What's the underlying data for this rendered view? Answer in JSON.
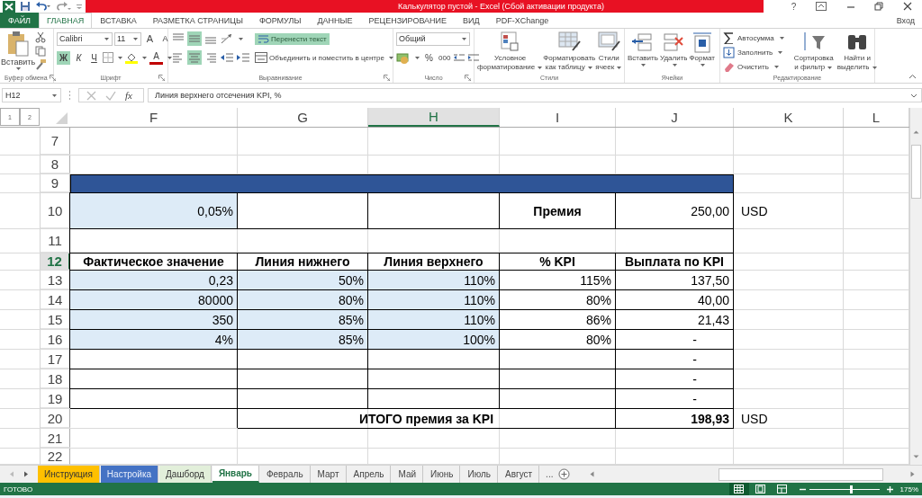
{
  "window": {
    "title": "Калькулятор пустой -  Excel (Сбой активации продукта)",
    "help": "?"
  },
  "ribbon_tabs": [
    {
      "label": "ФАЙЛ",
      "kind": "file",
      "selected": false
    },
    {
      "label": "ГЛАВНАЯ",
      "kind": "tab",
      "selected": true
    },
    {
      "label": "ВСТАВКА",
      "kind": "tab",
      "selected": false
    },
    {
      "label": "РАЗМЕТКА СТРАНИЦЫ",
      "kind": "tab",
      "selected": false
    },
    {
      "label": "ФОРМУЛЫ",
      "kind": "tab",
      "selected": false
    },
    {
      "label": "ДАННЫЕ",
      "kind": "tab",
      "selected": false
    },
    {
      "label": "РЕЦЕНЗИРОВАНИЕ",
      "kind": "tab",
      "selected": false
    },
    {
      "label": "ВИД",
      "kind": "tab",
      "selected": false
    },
    {
      "label": "PDF-XChange",
      "kind": "tab",
      "selected": false
    }
  ],
  "account": "Вход",
  "ribbon": {
    "groups": [
      {
        "kind": "clipboard",
        "label": "Буфер обмена",
        "paste": "Вставить"
      },
      {
        "kind": "font",
        "label": "Шрифт",
        "font": "Calibri",
        "size": "11",
        "grow": "A",
        "shrink": "A",
        "font_color": "A",
        "styles": [
          {
            "text": "Ж",
            "kind": "bold",
            "on": true
          },
          {
            "text": "К",
            "kind": "italic",
            "on": false
          },
          {
            "text": "Ч",
            "kind": "underline",
            "on": false
          }
        ]
      },
      {
        "kind": "alignment",
        "label": "Выравнивание",
        "valign": [
          {
            "on": false
          },
          {
            "on": true
          },
          {
            "on": false
          }
        ],
        "halign": [
          {
            "on": false
          },
          {
            "on": true
          },
          {
            "on": false
          }
        ],
        "wrap": {
          "text": "Перенести текст",
          "on": true
        },
        "merge": "Объединить и поместить в центре"
      },
      {
        "kind": "number",
        "label": "Число",
        "format": "Общий",
        "percent": "%",
        "thousands": "000"
      },
      {
        "kind": "styles",
        "label": "Стили",
        "buttons": [
          {
            "kind": "conditional",
            "lines": [
              "Условное",
              "форматирование"
            ]
          },
          {
            "kind": "table",
            "lines": [
              "Форматировать",
              "как таблицу"
            ]
          },
          {
            "kind": "cellstyle",
            "lines": [
              "Стили",
              "ячеек"
            ]
          }
        ]
      },
      {
        "kind": "cells",
        "label": "Ячейки",
        "buttons": [
          {
            "kind": "insert",
            "text": "Вставить"
          },
          {
            "kind": "delete",
            "text": "Удалить"
          },
          {
            "kind": "format",
            "text": "Формат"
          }
        ]
      },
      {
        "kind": "editing",
        "label": "Редактирование",
        "small": [
          {
            "kind": "sum",
            "text": "Автосумма"
          },
          {
            "kind": "fill",
            "text": "Заполнить"
          },
          {
            "kind": "clear",
            "text": "Очистить"
          }
        ],
        "buttons": [
          {
            "kind": "sort",
            "lines": [
              "Сортировка",
              "и фильтр"
            ]
          },
          {
            "kind": "find",
            "lines": [
              "Найти и",
              "выделить"
            ]
          }
        ]
      }
    ]
  },
  "formula_bar": {
    "name_box": "H12",
    "fx": "fx",
    "formula": "Линия верхнего отсечения KPI, %"
  },
  "outline_levels": [
    "1",
    "2"
  ],
  "columns": [
    {
      "label": "F",
      "selected": false
    },
    {
      "label": "G",
      "selected": false
    },
    {
      "label": "H",
      "selected": true
    },
    {
      "label": "I",
      "selected": false
    },
    {
      "label": "J",
      "selected": false
    },
    {
      "label": "K",
      "selected": false
    },
    {
      "label": "L",
      "selected": false
    }
  ],
  "rows": [
    {
      "number": "7",
      "selected": false,
      "cells": []
    },
    {
      "number": "8",
      "selected": false,
      "cells": []
    },
    {
      "number": "9",
      "selected": false,
      "cells": [
        {
          "kind": "band"
        },
        {
          "merged": true
        },
        {
          "merged": true
        },
        {
          "merged": true
        },
        {
          "merged": true
        }
      ]
    },
    {
      "number": "10",
      "selected": false,
      "cells": [
        {
          "kind": "input",
          "text": "0,05%"
        },
        {
          "kind": "box"
        },
        {
          "kind": "box"
        },
        {
          "kind": "label",
          "text": "Премия"
        },
        {
          "kind": "box",
          "text": "250,00"
        },
        {
          "kind": "plain",
          "text": "USD"
        }
      ]
    },
    {
      "number": "11",
      "selected": false,
      "cells": [
        {
          "kind": "box"
        },
        {
          "merged": true
        },
        {
          "merged": true
        },
        {
          "merged": true
        },
        {
          "merged": true
        }
      ]
    },
    {
      "number": "12",
      "selected": true,
      "cells": [
        {
          "kind": "label",
          "text": "Фактическое значение"
        },
        {
          "kind": "label",
          "text": "Линия нижнего"
        },
        {
          "kind": "label",
          "text": "Линия верхнего"
        },
        {
          "kind": "label",
          "text": "% KPI"
        },
        {
          "kind": "label",
          "text": "Выплата по KPI"
        }
      ]
    },
    {
      "number": "13",
      "selected": false,
      "cells": [
        {
          "kind": "input",
          "text": "0,23"
        },
        {
          "kind": "input",
          "text": "50%"
        },
        {
          "kind": "input",
          "text": "110%"
        },
        {
          "kind": "box",
          "text": "115%"
        },
        {
          "kind": "box",
          "text": "137,50"
        }
      ]
    },
    {
      "number": "14",
      "selected": false,
      "cells": [
        {
          "kind": "input",
          "text": "80000"
        },
        {
          "kind": "input",
          "text": "80%"
        },
        {
          "kind": "input",
          "text": "110%"
        },
        {
          "kind": "box",
          "text": "80%"
        },
        {
          "kind": "box",
          "text": "40,00"
        }
      ]
    },
    {
      "number": "15",
      "selected": false,
      "cells": [
        {
          "kind": "input",
          "text": "350"
        },
        {
          "kind": "input",
          "text": "85%"
        },
        {
          "kind": "input",
          "text": "110%"
        },
        {
          "kind": "box",
          "text": "86%"
        },
        {
          "kind": "box",
          "text": "21,43"
        }
      ]
    },
    {
      "number": "16",
      "selected": false,
      "cells": [
        {
          "kind": "input",
          "text": "4%"
        },
        {
          "kind": "input",
          "text": "85%"
        },
        {
          "kind": "input",
          "text": "100%"
        },
        {
          "kind": "box",
          "text": "80%"
        },
        {
          "kind": "dash",
          "text": "-"
        }
      ]
    },
    {
      "number": "17",
      "selected": false,
      "cells": [
        {
          "kind": "box"
        },
        {
          "kind": "box"
        },
        {
          "kind": "box"
        },
        {
          "kind": "box"
        },
        {
          "kind": "dash",
          "text": "-"
        }
      ]
    },
    {
      "number": "18",
      "selected": false,
      "cells": [
        {
          "kind": "box"
        },
        {
          "kind": "box"
        },
        {
          "kind": "box"
        },
        {
          "kind": "box"
        },
        {
          "kind": "dash",
          "text": "-"
        }
      ]
    },
    {
      "number": "19",
      "selected": false,
      "cells": [
        {
          "kind": "box"
        },
        {
          "kind": "box"
        },
        {
          "kind": "box"
        },
        {
          "kind": "box"
        },
        {
          "kind": "dash",
          "text": "-"
        }
      ]
    },
    {
      "number": "20",
      "selected": false,
      "cells": [
        {
          "kind": "blank"
        },
        {
          "kind": "label",
          "text": "ИТОГО премия за KPI"
        },
        {
          "merged": true
        },
        {
          "merged": true
        },
        {
          "kind": "sum",
          "text": "198,93"
        },
        {
          "kind": "plain",
          "text": "USD"
        }
      ]
    },
    {
      "number": "21",
      "selected": false,
      "cells": []
    },
    {
      "number": "22",
      "selected": false,
      "cells": []
    }
  ],
  "sheet_tabs": [
    {
      "label": "Инструкция",
      "color": "#ffc000",
      "selected": false
    },
    {
      "label": "Настройка",
      "color": "#4472c4",
      "selected": false
    },
    {
      "label": "Дашборд",
      "color": "#e2efda",
      "selected": false
    },
    {
      "label": "Январь",
      "selected": true
    },
    {
      "label": "Февраль",
      "selected": false
    },
    {
      "label": "Март",
      "selected": false
    },
    {
      "label": "Апрель",
      "selected": false
    },
    {
      "label": "Май",
      "selected": false
    },
    {
      "label": "Июнь",
      "selected": false
    },
    {
      "label": "Июль",
      "selected": false
    },
    {
      "label": "Август",
      "selected": false
    }
  ],
  "more_tabs": "...",
  "status_bar": {
    "text": "ГОТОВО",
    "views": [
      {
        "kind": "normal",
        "selected": true
      },
      {
        "kind": "layout",
        "selected": false
      },
      {
        "kind": "pagebreak",
        "selected": false
      }
    ],
    "zoom": {
      "level": 0.59,
      "reading": "175%"
    }
  }
}
